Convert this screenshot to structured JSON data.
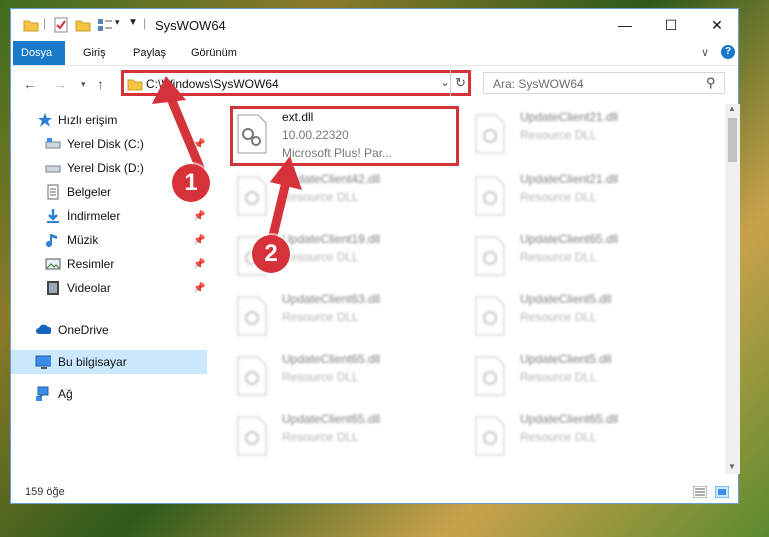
{
  "window": {
    "title": "SysWOW64",
    "minimize_icon": "—",
    "maximize_icon": "☐",
    "close_icon": "✕"
  },
  "ribbon": {
    "tabs": [
      "Dosya",
      "Giriş",
      "Paylaş",
      "Görünüm"
    ],
    "expand_icon": "∨",
    "help_icon": "?"
  },
  "address": {
    "path": "C:\\Windows\\SysWOW64",
    "dropdown_icon": "⌄",
    "refresh_icon": "↻"
  },
  "search": {
    "placeholder": "Ara: SysWOW64",
    "icon": "⚲"
  },
  "sidebar": {
    "items": [
      {
        "label": "Hızlı erişim",
        "icon": "star-icon"
      },
      {
        "label": "Yerel Disk (C:)",
        "icon": "drive-icon",
        "pinned": true
      },
      {
        "label": "Yerel Disk (D:)",
        "icon": "drive-icon",
        "pinned": false
      },
      {
        "label": "Belgeler",
        "icon": "document-icon",
        "pinned": false
      },
      {
        "label": "İndirmeler",
        "icon": "download-icon",
        "pinned": true
      },
      {
        "label": "Müzik",
        "icon": "music-icon",
        "pinned": true
      },
      {
        "label": "Resimler",
        "icon": "pictures-icon",
        "pinned": true
      },
      {
        "label": "Videolar",
        "icon": "video-icon",
        "pinned": true
      },
      {
        "label": "OneDrive",
        "icon": "cloud-icon"
      },
      {
        "label": "Bu bilgisayar",
        "icon": "computer-icon"
      },
      {
        "label": "Ağ",
        "icon": "network-icon"
      }
    ],
    "pin_glyph": "📌"
  },
  "files": [
    {
      "name": "ext.dll",
      "version": "10.00.22320",
      "desc": "Microsoft Plus! Par..."
    },
    {
      "name": "UpdateClient21.dll",
      "desc": "Resource DLL"
    },
    {
      "name": "UpdateClient42.dll",
      "desc": "Resource DLL"
    },
    {
      "name": "UpdateClient21.dll",
      "desc": "Resource DLL"
    },
    {
      "name": "UpdateClient19.dll",
      "desc": "Resource DLL"
    },
    {
      "name": "UpdateClient65.dll",
      "desc": "Resource DLL"
    },
    {
      "name": "UpdateClient63.dll",
      "desc": "Resource DLL"
    },
    {
      "name": "UpdateClient5.dll",
      "desc": "Resource DLL"
    },
    {
      "name": "UpdateClient65.dll",
      "desc": "Resource DLL"
    },
    {
      "name": "UpdateClient5.dll",
      "desc": "Resource DLL"
    },
    {
      "name": "UpdateClient65.dll",
      "desc": "Resource DLL"
    },
    {
      "name": "UpdateClient65.dll",
      "desc": "Resource DLL"
    }
  ],
  "status": {
    "count": "159 öğe"
  },
  "annotations": {
    "marker1": "1",
    "marker2": "2"
  },
  "colors": {
    "accent": "#1979ca",
    "highlight": "#d6323a",
    "selected": "#cce8ff"
  }
}
